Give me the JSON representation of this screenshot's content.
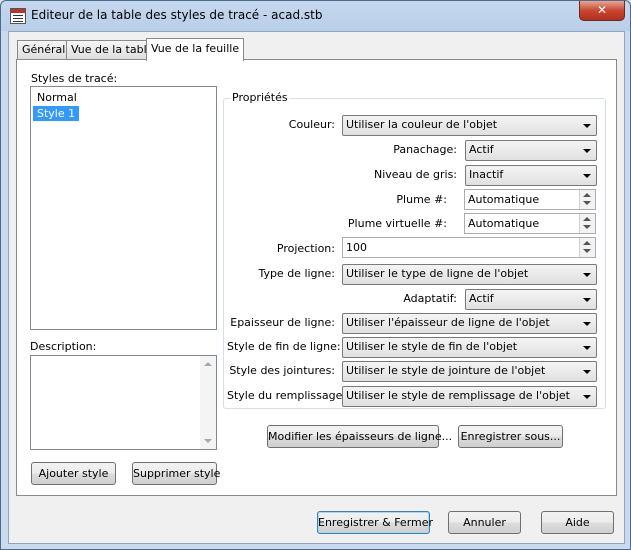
{
  "window": {
    "title": "Editeur de la table des styles de tracé - acad.stb",
    "close_label": "✕"
  },
  "tabs": [
    {
      "label": "Général"
    },
    {
      "label": "Vue de la table"
    },
    {
      "label": "Vue de la feuille"
    }
  ],
  "styles_panel": {
    "label": "Styles de tracé:",
    "items": [
      "Normal",
      "Style 1"
    ],
    "selected": "Style 1",
    "description_label": "Description:",
    "description_value": "",
    "add_button": "Ajouter style",
    "delete_button": "Supprimer style"
  },
  "properties": {
    "group_label": "Propriétés",
    "couleur": {
      "label": "Couleur:",
      "value": "Utiliser la couleur de l'objet"
    },
    "panachage": {
      "label": "Panachage:",
      "value": "Actif"
    },
    "niveau_gris": {
      "label": "Niveau de gris:",
      "value": "Inactif"
    },
    "plume": {
      "label": "Plume #:",
      "value": "Automatique"
    },
    "plume_virtuelle": {
      "label": "Plume virtuelle #:",
      "value": "Automatique"
    },
    "projection": {
      "label": "Projection:",
      "value": "100"
    },
    "type_ligne": {
      "label": "Type de ligne:",
      "value": "Utiliser le type de ligne de l'objet"
    },
    "adaptatif": {
      "label": "Adaptatif:",
      "value": "Actif"
    },
    "epaisseur": {
      "label": "Epaisseur de ligne:",
      "value": "Utiliser l'épaisseur de ligne de l'objet"
    },
    "style_fin": {
      "label": "Style de fin de ligne:",
      "value": "Utiliser le style de fin de l'objet"
    },
    "style_jointures": {
      "label": "Style des jointures:",
      "value": "Utiliser le style de jointure de l'objet"
    },
    "style_remplissage": {
      "label": "Style du remplissage:",
      "value": "Utiliser le style de remplissage de l'objet"
    }
  },
  "actions": {
    "modify_weights": "Modifier les épaisseurs de ligne...",
    "save_as": "Enregistrer sous..."
  },
  "footer": {
    "save_close": "Enregistrer & Fermer",
    "cancel": "Annuler",
    "help": "Aide"
  }
}
